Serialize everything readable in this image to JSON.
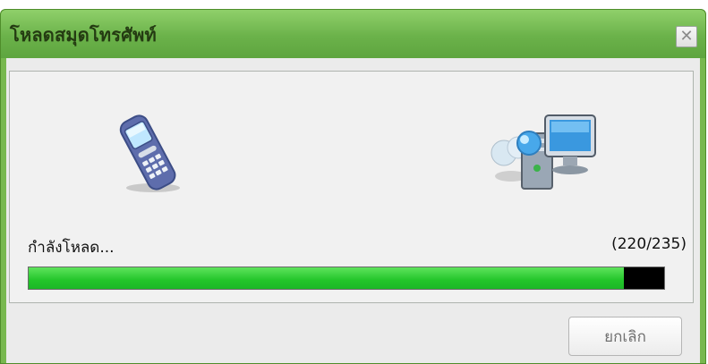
{
  "window": {
    "title": "โหลดสมุดโทรศัพท์",
    "close_icon": "close-icon"
  },
  "icons": {
    "phone": "mobile-phone-icon",
    "computer": "computer-icon"
  },
  "progress": {
    "status_text": "กำลังโหลด...",
    "count_text": "(220/235)",
    "current": 220,
    "total": 235,
    "fraction": 0.936
  },
  "actions": {
    "cancel_label": "ยกเลิก"
  },
  "colors": {
    "title_bar": "#6bb24a",
    "progress_fill": "#23c52a",
    "progress_track": "#000000"
  }
}
